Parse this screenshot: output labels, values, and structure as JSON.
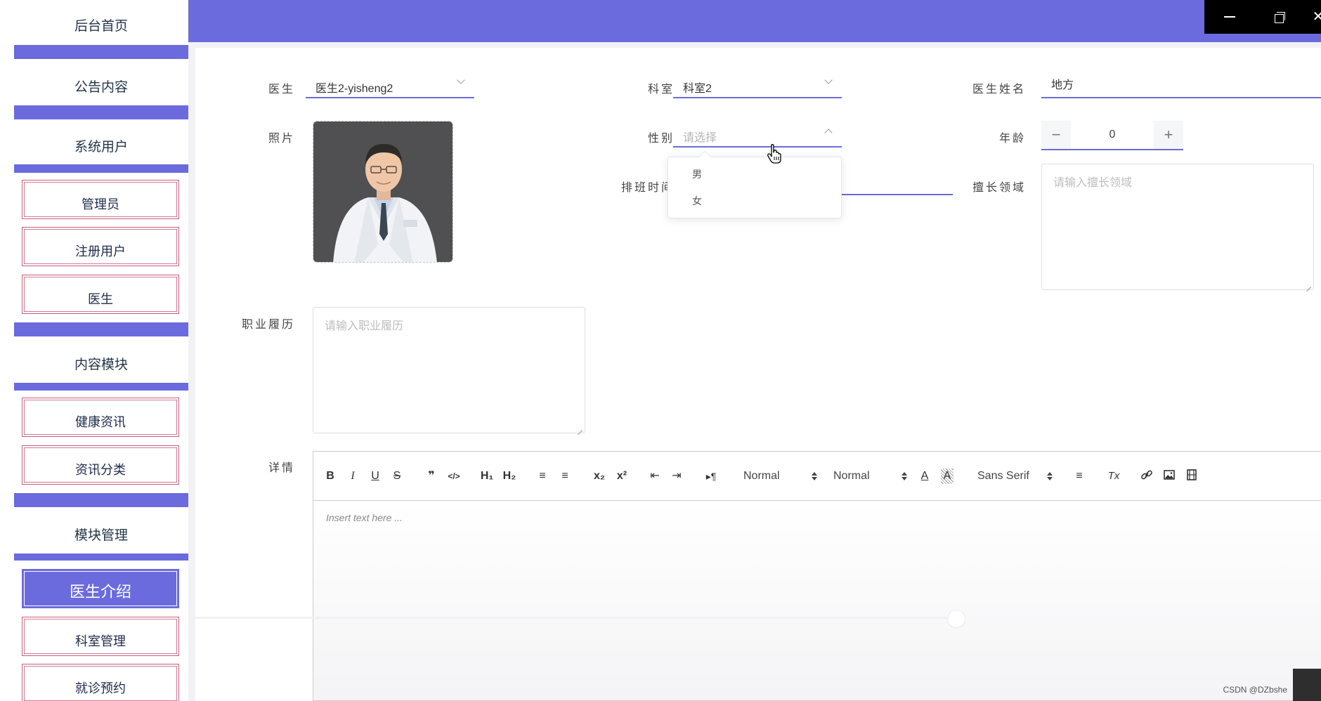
{
  "window": {
    "minimize_glyph": "",
    "close_glyph": "✕"
  },
  "sidebar": {
    "home": "后台首页",
    "notice": "公告内容",
    "system_users": "系统用户",
    "admin": "管理员",
    "registered_users": "注册用户",
    "doctor": "医生",
    "content_module": "内容模块",
    "health_news": "健康资讯",
    "news_category": "资讯分类",
    "module_management": "模块管理",
    "doctor_intro": "医生介绍",
    "department_management": "科室管理",
    "appointment": "就诊预约"
  },
  "form": {
    "doctor": {
      "label": "医生",
      "value": "医生2-yisheng2"
    },
    "department": {
      "label": "科室",
      "value": "科室2"
    },
    "doctor_name": {
      "label": "医生姓名",
      "value": "地方"
    },
    "photo": {
      "label": "照片"
    },
    "gender": {
      "label": "性别",
      "placeholder": "请选择",
      "options": [
        "男",
        "女"
      ]
    },
    "age": {
      "label": "年龄",
      "value": "0",
      "minus": "−",
      "plus": "+"
    },
    "schedule": {
      "label": "排班时间"
    },
    "specialty": {
      "label": "擅长领域",
      "placeholder": "请输入擅长领域"
    },
    "career": {
      "label": "职业履历",
      "placeholder": "请输入职业履历"
    },
    "details": {
      "label": "详情"
    }
  },
  "editor": {
    "bold": "B",
    "italic": "I",
    "underline": "U",
    "strike": "S",
    "quote": "❞",
    "code": "</>",
    "h1": "H₁",
    "h2": "H₂",
    "ordered_list": "≡",
    "bullet_list": "≡",
    "subscript": "x₂",
    "superscript": "x²",
    "outdent": "⇤",
    "indent": "⇥",
    "rtl": "▸¶",
    "size_select": "Normal",
    "header_select": "Normal",
    "font_color": "A",
    "font_background": "A",
    "font_select": "Sans Serif",
    "align": "≡",
    "clean": "Tx",
    "placeholder": "Insert text here ..."
  },
  "watermark": "CSDN @DZbshe",
  "colors": {
    "accent": "#6b6bdd",
    "sidebar_border": "#c95c7b"
  }
}
